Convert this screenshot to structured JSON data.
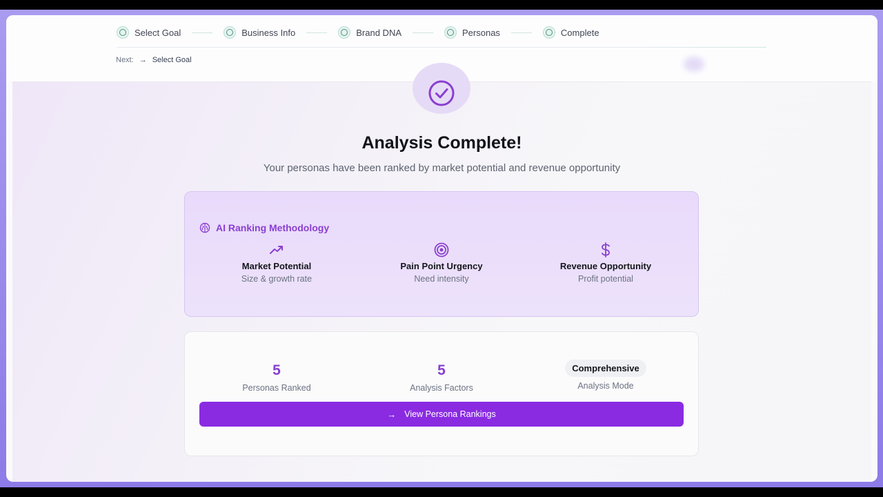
{
  "stepper": {
    "steps": [
      {
        "label": "Select Goal"
      },
      {
        "label": "Business Info"
      },
      {
        "label": "Brand DNA"
      },
      {
        "label": "Personas"
      },
      {
        "label": "Complete"
      }
    ],
    "next_prefix": "Next:",
    "next_target": "Select Goal"
  },
  "main": {
    "title": "Analysis Complete!",
    "subtitle": "Your personas have been ranked by market potential and revenue opportunity",
    "methodology": {
      "heading": "AI Ranking Methodology",
      "factors": [
        {
          "name": "Market Potential",
          "desc": "Size & growth rate",
          "icon": "trending-up-icon"
        },
        {
          "name": "Pain Point Urgency",
          "desc": "Need intensity",
          "icon": "target-icon"
        },
        {
          "name": "Revenue Opportunity",
          "desc": "Profit potential",
          "icon": "dollar-icon"
        }
      ]
    },
    "stats": {
      "personas_ranked_value": "5",
      "personas_ranked_label": "Personas Ranked",
      "analysis_factors_value": "5",
      "analysis_factors_label": "Analysis Factors",
      "mode_value": "Comprehensive",
      "mode_label": "Analysis Mode"
    },
    "cta_label": "View Persona Rankings"
  },
  "colors": {
    "accent": "#8a2be2",
    "accent_text": "#8a3fd0",
    "step_teal": "#4d8f7e",
    "frame_purple": "#9a89ec"
  }
}
